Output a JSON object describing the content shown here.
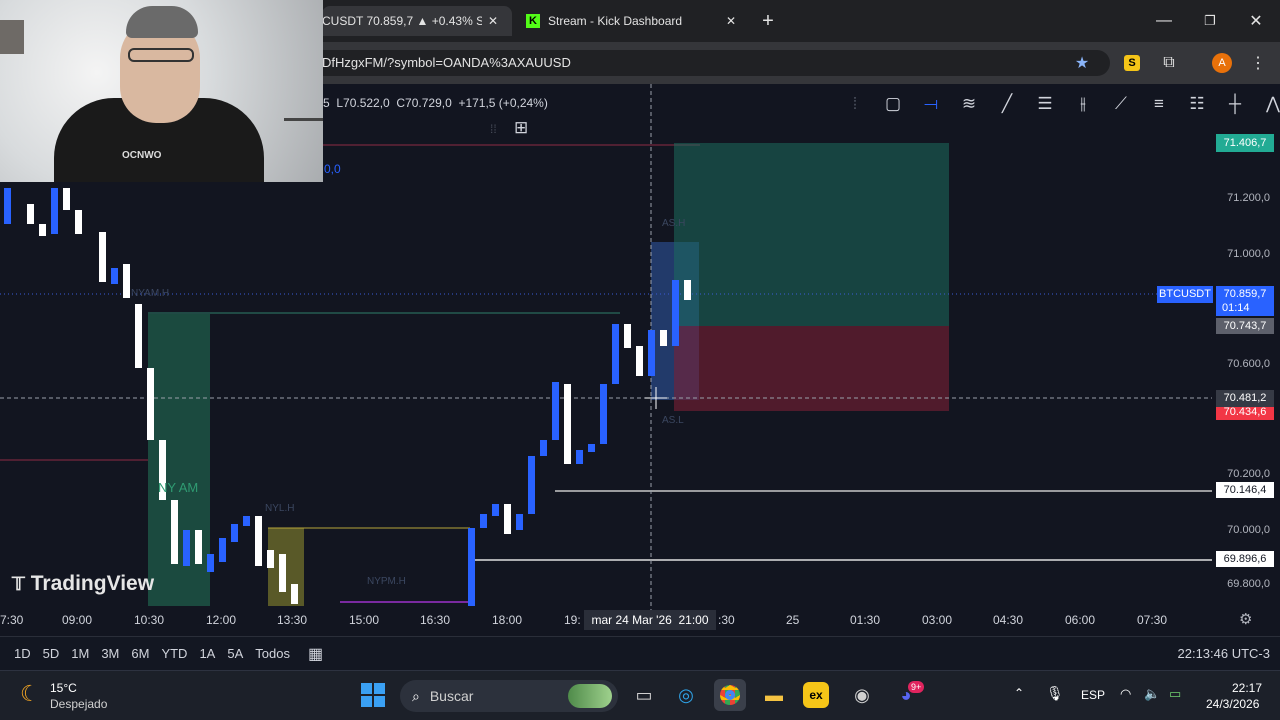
{
  "browser": {
    "tabs": [
      {
        "label": "CUSDT 70.859,7 ▲ +0.43% Si",
        "active": true
      },
      {
        "label": "Stream - Kick Dashboard",
        "active": false
      }
    ],
    "url": "DfHzgxFM/?symbol=OANDA%3AXAUUSD",
    "profile_initial": "A"
  },
  "chart": {
    "ohlc_text": "5  L70.522,0  C70.729,0  +171,5 (+0,24%)",
    "indicator_value": "0,0",
    "symbol_badge": "BTCUSDT",
    "current_price": "70.859,7",
    "countdown": "01:14",
    "price_labels": [
      {
        "text": "71.406,7",
        "kind": "green"
      },
      {
        "text": "71.200,0",
        "kind": "axis"
      },
      {
        "text": "71.000,0",
        "kind": "axis"
      },
      {
        "text": "70.743,7",
        "kind": "gray"
      },
      {
        "text": "70.600,0",
        "kind": "axis"
      },
      {
        "text": "70.481,2",
        "kind": "crosshair"
      },
      {
        "text": "70.434,6",
        "kind": "red"
      },
      {
        "text": "70.200,0",
        "kind": "axis"
      },
      {
        "text": "70.146,4",
        "kind": "line"
      },
      {
        "text": "70.000,0",
        "kind": "axis"
      },
      {
        "text": "69.896,6",
        "kind": "line"
      },
      {
        "text": "69.800,0",
        "kind": "axis"
      }
    ],
    "time_labels": [
      "7:30",
      "09:00",
      "10:30",
      "12:00",
      "13:30",
      "15:00",
      "16:30",
      "18:00",
      "19:",
      "21:00",
      ":30",
      "25",
      "01:30",
      "03:00",
      "04:30",
      "06:00",
      "07:30"
    ],
    "crosshair_date": "mar 24 Mar '26",
    "session_labels": [
      "NYAM.H",
      "NY AM",
      "NYL.H",
      "NYPM.H",
      "AS.H",
      "AS.L"
    ],
    "watermark": "TradingView"
  },
  "bottom_bar": {
    "ranges": [
      "1D",
      "5D",
      "1M",
      "3M",
      "6M",
      "YTD",
      "1A",
      "5A",
      "Todos"
    ],
    "clock": "22:13:46 UTC-3"
  },
  "taskbar": {
    "weather_temp": "15°C",
    "weather_desc": "Despejado",
    "search_placeholder": "Buscar",
    "lang": "ESP",
    "time": "22:17",
    "date": "24/3/2026",
    "discord_badge": "9+"
  }
}
